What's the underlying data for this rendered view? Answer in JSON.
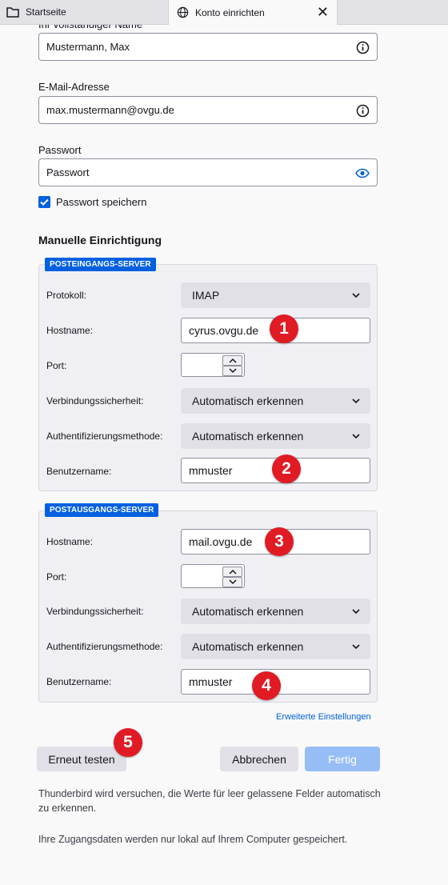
{
  "tabs": [
    {
      "label": "Startseite",
      "icon": "folder-icon"
    },
    {
      "label": "Konto einrichten",
      "icon": "globe-icon",
      "close": "✕"
    }
  ],
  "form": {
    "name_label": "Ihr vollständiger Name",
    "name_value": "Mustermann, Max",
    "email_label": "E-Mail-Adresse",
    "email_value": "max.mustermann@ovgu.de",
    "password_label": "Passwort",
    "password_value": "Passwort",
    "save_password_label": "Passwort speichern",
    "save_password_checked": true
  },
  "manual": {
    "title": "Manuelle Einrichtigung",
    "incoming": {
      "badge": "POSTEINGANGS-SERVER",
      "protocol_label": "Protokoll:",
      "protocol_value": "IMAP",
      "hostname_label": "Hostname:",
      "hostname_value": "cyrus.ovgu.de",
      "port_label": "Port:",
      "port_value": "",
      "security_label": "Verbindungssicherheit:",
      "security_value": "Automatisch erkennen",
      "auth_label": "Authentifizierungsmethode:",
      "auth_value": "Automatisch erkennen",
      "username_label": "Benutzername:",
      "username_value": "mmuster"
    },
    "outgoing": {
      "badge": "POSTAUSGANGS-SERVER",
      "hostname_label": "Hostname:",
      "hostname_value": "mail.ovgu.de",
      "port_label": "Port:",
      "port_value": "",
      "security_label": "Verbindungssicherheit:",
      "security_value": "Automatisch erkennen",
      "auth_label": "Authentifizierungsmethode:",
      "auth_value": "Automatisch erkennen",
      "username_label": "Benutzername:",
      "username_value": "mmuster"
    },
    "advanced_link": "Erweiterte Einstellungen"
  },
  "markers": [
    "1",
    "2",
    "3",
    "4",
    "5"
  ],
  "buttons": {
    "retry": "Erneut testen",
    "cancel": "Abbrechen",
    "done": "Fertig"
  },
  "notes": [
    "Thunderbird wird versuchen, die Werte für leer gelassene Felder automatisch zu erkennen.",
    "Ihre Zugangsdaten werden nur lokal auf Ihrem Computer gespeichert."
  ],
  "colors": {
    "accent": "#0060df",
    "marker": "#e01b24",
    "done_disabled": "#96bdf5"
  }
}
